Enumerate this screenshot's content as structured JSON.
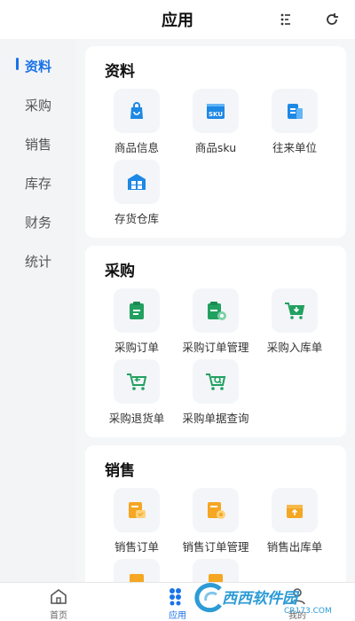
{
  "header": {
    "title": "应用",
    "menu_icon": "more-dots-icon",
    "refresh_icon": "refresh-icon"
  },
  "sidebar": {
    "active_color": "#1a73e8",
    "items": [
      {
        "label": "资料",
        "active": true
      },
      {
        "label": "采购",
        "active": false
      },
      {
        "label": "销售",
        "active": false
      },
      {
        "label": "库存",
        "active": false
      },
      {
        "label": "财务",
        "active": false
      },
      {
        "label": "统计",
        "active": false
      }
    ]
  },
  "sections": [
    {
      "title": "资料",
      "apps": [
        {
          "label": "商品信息",
          "icon": "shopping-bag-icon",
          "color": "#1e88e5"
        },
        {
          "label": "商品sku",
          "icon": "sku-icon",
          "color": "#1e88e5"
        },
        {
          "label": "往来单位",
          "icon": "building-icon",
          "color": "#1e88e5"
        },
        {
          "label": "存货仓库",
          "icon": "warehouse-icon",
          "color": "#1e88e5"
        }
      ]
    },
    {
      "title": "采购",
      "apps": [
        {
          "label": "采购订单",
          "icon": "clipboard-icon",
          "color": "#21a060"
        },
        {
          "label": "采购订单管理",
          "icon": "clipboard-gear-icon",
          "color": "#21a060"
        },
        {
          "label": "采购入库单",
          "icon": "cart-in-icon",
          "color": "#21a060"
        },
        {
          "label": "采购退货单",
          "icon": "cart-return-icon",
          "color": "#21a060"
        },
        {
          "label": "采购单据查询",
          "icon": "cart-search-icon",
          "color": "#21a060"
        }
      ]
    },
    {
      "title": "销售",
      "apps": [
        {
          "label": "销售订单",
          "icon": "sales-order-icon",
          "color": "#f5a623"
        },
        {
          "label": "销售订单管理",
          "icon": "sales-order-gear-icon",
          "color": "#f5a623"
        },
        {
          "label": "销售出库单",
          "icon": "box-out-icon",
          "color": "#f5a623"
        }
      ]
    }
  ],
  "tabbar": {
    "items": [
      {
        "label": "首页",
        "icon": "home-icon",
        "active": false
      },
      {
        "label": "应用",
        "icon": "apps-icon",
        "active": true
      },
      {
        "label": "我的",
        "icon": "user-icon",
        "active": false
      }
    ]
  },
  "watermark": {
    "text": "西西软件园",
    "sub": "CR173.COM"
  }
}
